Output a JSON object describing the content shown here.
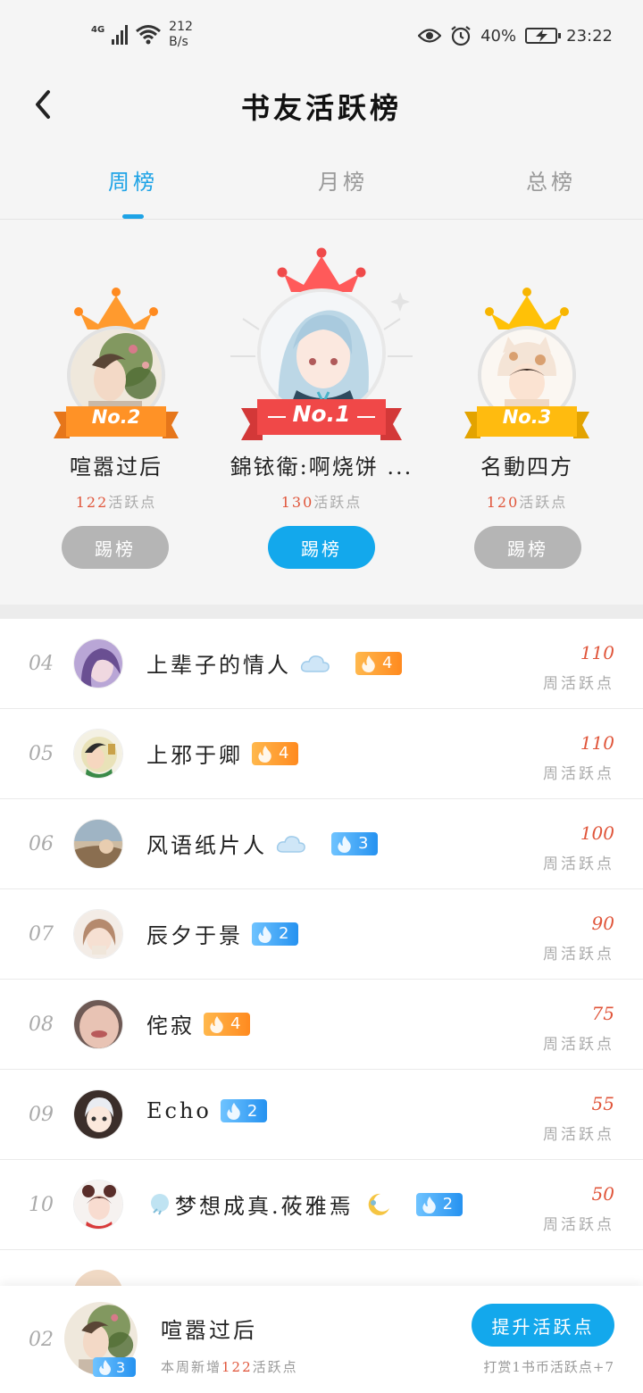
{
  "status_bar": {
    "network": "4G",
    "speed_value": "212",
    "speed_unit": "B/s",
    "battery": "40%",
    "time": "23:22"
  },
  "header": {
    "title": "书友活跃榜"
  },
  "tabs": [
    {
      "label": "周榜",
      "active": true
    },
    {
      "label": "月榜",
      "active": false
    },
    {
      "label": "总榜",
      "active": false
    }
  ],
  "podium": {
    "first": {
      "badge": "No.1",
      "name": "錦铱衛:啊烧饼 ...",
      "points": "130",
      "points_suffix": "活跃点",
      "button": "踢榜"
    },
    "second": {
      "badge": "No.2",
      "name": "喧嚣过后",
      "points": "122",
      "points_suffix": "活跃点",
      "button": "踢榜"
    },
    "third": {
      "badge": "No.3",
      "name": "名動四方",
      "points": "120",
      "points_suffix": "活跃点",
      "button": "踢榜"
    }
  },
  "list": [
    {
      "rank": "04",
      "name": "上辈子的情人",
      "cloud": true,
      "level": "4",
      "level_color": "orange",
      "score": "110",
      "label": "周活跃点"
    },
    {
      "rank": "05",
      "name": "上邪于卿",
      "cloud": false,
      "level": "4",
      "level_color": "orange",
      "score": "110",
      "label": "周活跃点"
    },
    {
      "rank": "06",
      "name": "风语纸片人",
      "cloud": true,
      "level": "3",
      "level_color": "blue",
      "score": "100",
      "label": "周活跃点"
    },
    {
      "rank": "07",
      "name": "辰夕于景",
      "cloud": false,
      "level": "2",
      "level_color": "blue",
      "score": "90",
      "label": "周活跃点"
    },
    {
      "rank": "08",
      "name": "侘寂",
      "cloud": false,
      "level": "4",
      "level_color": "orange",
      "score": "75",
      "label": "周活跃点"
    },
    {
      "rank": "09",
      "name": "Echo",
      "cloud": false,
      "level": "2",
      "level_color": "blue",
      "score": "55",
      "label": "周活跃点"
    },
    {
      "rank": "10",
      "name": "梦想成真.莜雅焉",
      "cloud": false,
      "level": "2",
      "level_color": "blue",
      "score": "50",
      "label": "周活跃点"
    }
  ],
  "me": {
    "rank": "02",
    "level": "3",
    "name": "喧嚣过后",
    "sub_prefix": "本周新增",
    "sub_num": "122",
    "sub_suffix": "活跃点",
    "boost_button": "提升活跃点",
    "reward_text": "打赏1书币活跃点+7"
  },
  "colors": {
    "accent": "#13a8ec",
    "tab_active": "#1ea3e6",
    "score_red": "#e0553a",
    "gold": "#f7b500",
    "orange": "#ff8a1f",
    "red": "#ef4a4a"
  }
}
